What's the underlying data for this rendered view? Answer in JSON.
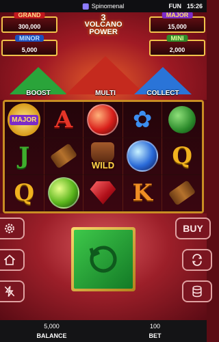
{
  "status_bar": {
    "app_name": "Spinomenal",
    "mode": "FUN",
    "time": "15:26"
  },
  "title": {
    "number": "3",
    "line1": "VOLCANO",
    "line2": "POWER"
  },
  "jackpots": {
    "grand": {
      "label": "GRAND",
      "value": "300,000"
    },
    "minor": {
      "label": "MINOR",
      "value": "5,000"
    },
    "major": {
      "label": "MAJOR",
      "value": "15,000"
    },
    "mini": {
      "label": "MINI",
      "value": "2,000"
    }
  },
  "volcanoes": [
    {
      "label": "BOOST",
      "color": "#2aa43a"
    },
    {
      "label": "MULTI",
      "color": "#c52a1e"
    },
    {
      "label": "COLLECT",
      "color": "#2a74d8"
    }
  ],
  "reels": {
    "wild_label": "WILD",
    "major_coin_label": "MAJOR",
    "letters": {
      "a": "A",
      "j": "J",
      "q1": "Q",
      "q2": "Q",
      "k": "K"
    }
  },
  "controls": {
    "buy_label": "BUY"
  },
  "footer": {
    "balance_value": "5,000",
    "balance_label": "BALANCE",
    "bet_value": "100",
    "bet_label": "BET"
  },
  "colors": {
    "accent_gold": "#c98d23",
    "spin_green": "#3ec84a"
  }
}
